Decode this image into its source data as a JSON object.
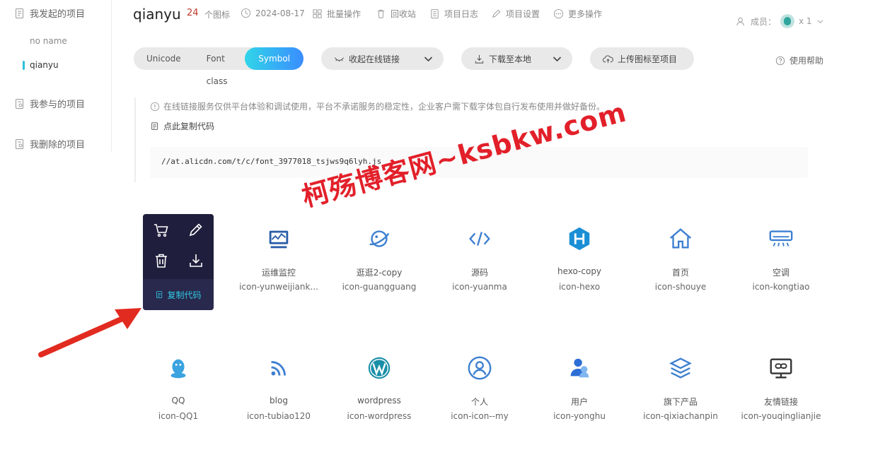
{
  "sidebar": {
    "my_projects": "我发起的项目",
    "projects": [
      "no name",
      "qianyu"
    ],
    "joined": "我参与的项目",
    "deleted": "我删除的项目"
  },
  "header": {
    "title": "qianyu",
    "icon_count": "24",
    "icon_count_label": "个图标",
    "date": "2024-08-17",
    "batch": "批量操作",
    "recycle": "回收站",
    "log": "项目日志",
    "settings": "项目设置",
    "more": "更多操作",
    "members_label": "成员：",
    "members_count": "x 1"
  },
  "toolbar": {
    "tabs": [
      "Unicode",
      "Font class",
      "Symbol"
    ],
    "active_tab": "Symbol",
    "collapse_link": "收起在线链接",
    "download": "下载至本地",
    "upload": "上传图标至项目",
    "help": "使用帮助"
  },
  "notice": {
    "text": "在线链接服务仅供平台体验和调试使用，平台不承诺服务的稳定性，企业客户需下载字体包自行发布使用并做好备份。",
    "copy_code": "点此复制代码",
    "code_url": "//at.alicdn.com/t/c/font_3977018_tsjws9q6lyh.js"
  },
  "popup": {
    "copy_code": "复制代码"
  },
  "icons": [
    {
      "name": "运维监控",
      "code": "icon-yunweijiank..."
    },
    {
      "name": "逛逛2-copy",
      "code": "icon-guangguang"
    },
    {
      "name": "源码",
      "code": "icon-yuanma"
    },
    {
      "name": "hexo-copy",
      "code": "icon-hexo"
    },
    {
      "name": "首页",
      "code": "icon-shouye"
    },
    {
      "name": "空调",
      "code": "icon-kongtiao"
    },
    {
      "name": "QQ",
      "code": "icon-QQ1"
    },
    {
      "name": "blog",
      "code": "icon-tubiao120"
    },
    {
      "name": "wordpress",
      "code": "icon-wordpress"
    },
    {
      "name": "个人",
      "code": "icon-icon--my"
    },
    {
      "name": "用户",
      "code": "icon-yonghu"
    },
    {
      "name": "旗下产品",
      "code": "icon-qixiachanpin"
    },
    {
      "name": "友情链接",
      "code": "icon-youqinglianjie"
    }
  ],
  "watermark": "柯殇博客网~ksbkw.com",
  "colors": {
    "accent": "#2dc0d9",
    "count_red": "#c0392b",
    "popup_bg": "#1f1f3d",
    "icon_blue": "#3d7fd1",
    "watermark_red": "#e2202a"
  }
}
